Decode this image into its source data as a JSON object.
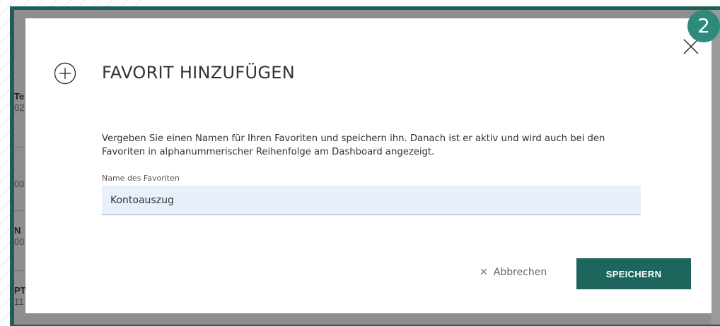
{
  "background": {
    "rows": [
      {
        "code": "Te",
        "num": "02"
      },
      {
        "code": "",
        "num": "00"
      },
      {
        "code": "N",
        "num": "00"
      },
      {
        "code": "PT",
        "num": "11"
      }
    ]
  },
  "dialog": {
    "title": "FAVORIT HINZUFÜGEN",
    "description": "Vergeben Sie einen Namen für Ihren Favoriten und speichern ihn. Danach ist er aktiv und wird auch bei den Favoriten in alphanummerischer Reihenfolge am Dashboard angezeigt.",
    "field": {
      "label": "Name des Favoriten",
      "value": "Kontoauszug"
    },
    "cancel_label": "Abbrechen",
    "save_label": "SPEICHERN",
    "step_badge": "2"
  },
  "colors": {
    "primary": "#1e665d",
    "badge": "#2f8a7e",
    "input_bg": "#e8f0fb"
  },
  "icons": [
    "plus-circle-icon",
    "close-icon",
    "x-icon"
  ]
}
